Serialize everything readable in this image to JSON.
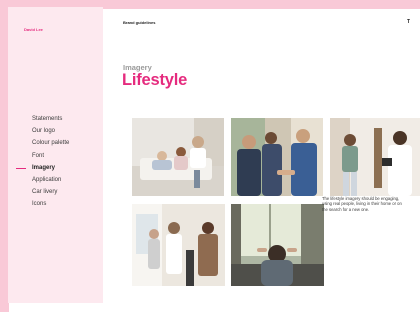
{
  "sidebar": {
    "brand": "David Lee",
    "items": [
      {
        "label": "Statements"
      },
      {
        "label": "Our logo"
      },
      {
        "label": "Colour palette"
      },
      {
        "label": "Font"
      },
      {
        "label": "Imagery",
        "active": true
      },
      {
        "label": "Application"
      },
      {
        "label": "Car livery"
      },
      {
        "label": "Icons"
      }
    ]
  },
  "header": {
    "doc_title": "Brand guidelines",
    "corner": "T"
  },
  "section": {
    "eyebrow": "Imagery",
    "title": "Lifestyle"
  },
  "photos": [
    {
      "icon": "family-on-sofa-photo"
    },
    {
      "icon": "handshake-photo"
    },
    {
      "icon": "tablet-conversation-photo"
    },
    {
      "icon": "viewing-group-photo"
    },
    {
      "icon": "relaxing-at-window-photo"
    }
  ],
  "caption": "The lifestyle imagery should be engaging, using real people, living in their home or on the search for a new one.",
  "colors": {
    "accent": "#e52b7e",
    "background": "#f9c9d7",
    "sidebar": "#fde9ef"
  }
}
